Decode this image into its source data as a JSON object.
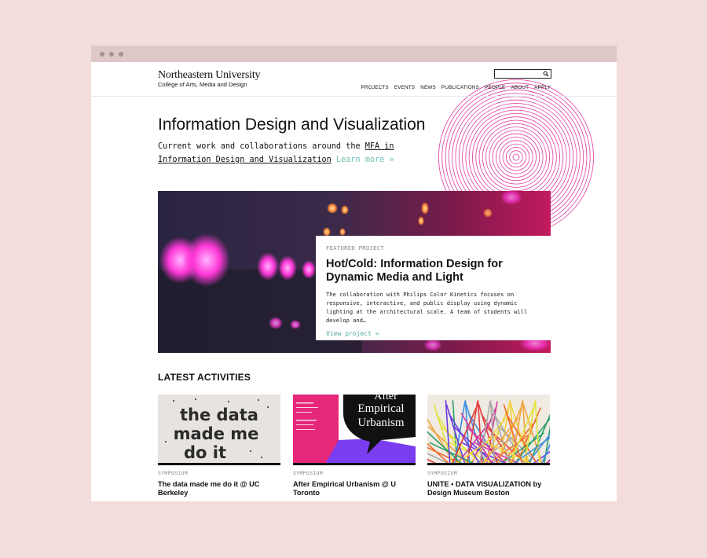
{
  "header": {
    "logo_name": "Northeastern University",
    "logo_sub": "College of Arts, Media and Design",
    "search": {
      "value": "",
      "placeholder": ""
    },
    "nav": [
      "PROJECTS",
      "EVENTS",
      "NEWS",
      "PUBLICATIONS",
      "PEOPLE",
      "ABOUT",
      "APPLY"
    ]
  },
  "hero": {
    "title": "Information Design and Visualization",
    "desc_prefix": "Current work and collaborations around the ",
    "desc_link": "MFA in Information Design and Visualization",
    "learn_more": "Learn more »"
  },
  "featured": {
    "kicker": "FEATURED PROJECT",
    "title": "Hot/Cold: Information Design for Dynamic Media and Light",
    "body": "The collaboration with Philips Color Kinetics focuses on responsive, interactive, and public display using dynamic lighting at the architectural scale. A team of students will develop and…",
    "link": "View project »"
  },
  "latest": {
    "heading": "LATEST ACTIVITIES",
    "tiles": [
      {
        "kind": "SYMPOSIUM",
        "title": "The data made me do it @ UC Berkeley",
        "thumb_text": [
          "the data",
          "made me",
          "do it"
        ]
      },
      {
        "kind": "SYMPOSIUM",
        "title": "After Empirical Urbanism @ U Toronto",
        "thumb_text": [
          "After",
          "Empirical",
          "Urbanism"
        ]
      },
      {
        "kind": "SYMPOSIUM",
        "title": "UNITE • DATA VISUALIZATION by Design Museum Boston"
      }
    ]
  },
  "colors": {
    "page_bg": "#f3dcdc",
    "accent_teal": "#6fc0b6",
    "deco_magenta": "#e23aa0",
    "deco_blue": "#3aa8e6"
  }
}
